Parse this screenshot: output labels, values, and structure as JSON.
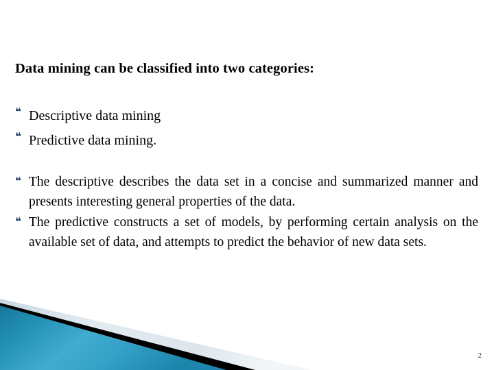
{
  "slide": {
    "number": "2",
    "background_color": "#FFFFFF",
    "bullet_glyph": "❝",
    "bullet_color": "#17365D",
    "text_color": "#000000"
  },
  "heading": {
    "text": "Data mining can be classified into two categories:"
  },
  "category_list": {
    "items": [
      {
        "text": "Descriptive data mining"
      },
      {
        "text": "Predictive data mining."
      }
    ]
  },
  "description_list": {
    "items": [
      {
        "text": "The descriptive  describes the data set in a concise and summarized manner and presents interesting general properties of the data."
      },
      {
        "text": "The predictive constructs a set of models, by performing certain  analysis on the available set of data, and attempts to predict the behavior of new data sets."
      }
    ]
  },
  "decoration": {
    "name": "bottom-left-angled-banner",
    "pale_band_color": "#DCE6EC",
    "pale_band_color_light": "#EFF4F7",
    "black_band_color": "#000000",
    "teal_gradient_start": "#1B7C9E",
    "teal_gradient_mid": "#3EA6CA",
    "teal_gradient_end": "#1E86AC"
  }
}
